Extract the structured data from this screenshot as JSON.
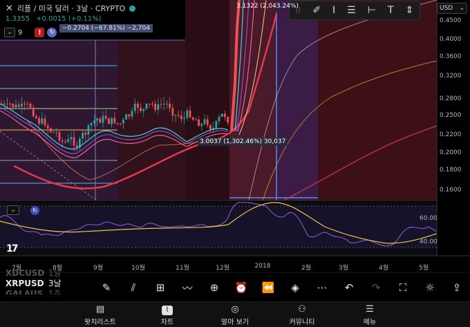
{
  "header": {
    "close_glyph": "✕",
    "title": "리플 / 미국 달러 · 3날 · CRYPTO",
    "status_color": "#26a69a",
    "price": "1.3355",
    "change": "+0.0015 (+0.11%)"
  },
  "indicator_row": {
    "count": "9",
    "warn_glyph": "!",
    "measure": "−0.2704 (−67.81%) −2,704"
  },
  "drawing_toolbar": {
    "icons": [
      "grip-icon",
      "brush-icon",
      "text-cursor-icon",
      "horizontal-lines-icon",
      "fib-icon",
      "text-icon",
      "vertical-line-icon"
    ]
  },
  "currency": {
    "value": "USD",
    "chevron": "⌄"
  },
  "price_axis": {
    "labels": [
      "0.4500",
      "0.4000",
      "0.3600",
      "0.3200",
      "0.2800",
      "0.2500",
      "0.2200",
      "0.2000",
      "0.1800",
      "0.1600"
    ]
  },
  "rsi_axis": {
    "labels": [
      "60.00",
      "40.00"
    ]
  },
  "time_axis": {
    "labels": [
      "7월",
      "8월",
      "9월",
      "10월",
      "11월",
      "12월",
      "2018",
      "2월",
      "3월",
      "4월",
      "5월"
    ]
  },
  "annotations": {
    "peak": "3.1322 (2,043.24%)",
    "marker": "3.0037 (1,302.46%) 30,037"
  },
  "watchlist": {
    "rows": [
      {
        "symbol": "XDCUSD",
        "tf": "1날"
      },
      {
        "symbol": "XRPUSD",
        "tf": "3날"
      },
      {
        "symbol": "GALAUS",
        "tf": "1주"
      }
    ]
  },
  "action_bar": {
    "icons": [
      "pencil-icon",
      "chart-add-icon",
      "grid-icon",
      "trend-icon",
      "plus-circle-icon",
      "alarm-icon",
      "replay-icon",
      "layers-icon",
      "more-icon",
      "undo-icon",
      "redo-icon",
      "fullscreen-icon",
      "bulb-icon",
      "share-icon"
    ]
  },
  "bottom_nav": {
    "items": [
      {
        "label": "왓치리스트",
        "icon": "watchlist-icon"
      },
      {
        "label": "차트",
        "icon": "chart-icon"
      },
      {
        "label": "알아 보기",
        "icon": "compass-icon"
      },
      {
        "label": "커뮤니티",
        "icon": "community-icon"
      },
      {
        "label": "메뉴",
        "icon": "menu-icon"
      }
    ]
  },
  "colors": {
    "up": "#26a69a",
    "down": "#ef5350",
    "rsi_line": "#7e57c2",
    "rsi_ma": "#e6c84a",
    "measure": "#5c6bc0"
  }
}
